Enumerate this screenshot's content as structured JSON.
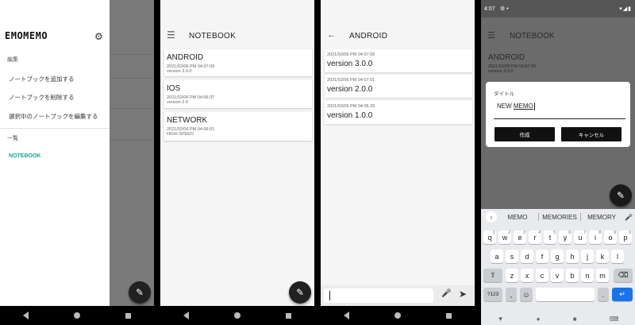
{
  "drawer": {
    "logo": "EMOMEMO",
    "section_edit": "編集",
    "item_add": "ノートブックを追加する",
    "item_delete": "ノートブックを削除する",
    "item_edit_selected": "選択中のノートブックを編集する",
    "section_list": "一覧",
    "notebook_item": "NOTEBOOK"
  },
  "notebook_screen": {
    "title": "NOTEBOOK",
    "notebooks": [
      {
        "title": "ANDROID",
        "date": "2021/02/06 PM 04:07:09",
        "desc": "version 3.0.0"
      },
      {
        "title": "IOS",
        "date": "2021/02/06 PM 04:06:37",
        "desc": "version 2.0"
      },
      {
        "title": "NETWORK",
        "date": "2021/02/06 PM 04:06:51",
        "desc": "HIGH SPEED"
      }
    ]
  },
  "android_screen": {
    "title": "ANDROID",
    "memos": [
      {
        "date": "2021/02/06 PM 04:07:09",
        "title": "version 3.0.0"
      },
      {
        "date": "2021/02/06 PM 04:07:01",
        "title": "version 2.0.0"
      },
      {
        "date": "2021/02/06 PM 04:06:29",
        "title": "version 1.0.0"
      }
    ]
  },
  "dialog_screen": {
    "status_time": "4:07",
    "bg_title": "NOTEBOOK",
    "bg_card_title": "ANDROID",
    "bg_card_date": "2021/02/06 PM 04:07:09",
    "bg_card_desc": "version 3.0.0",
    "dialog_label": "タイトル",
    "input_prefix": "NEW ",
    "input_underlined": "MEMO",
    "create_button": "作成",
    "cancel_button": "キャンセル"
  },
  "keyboard": {
    "suggestions": [
      "MEMO",
      "MEMORIES",
      "MEMORY"
    ],
    "row1": [
      [
        "q",
        "1"
      ],
      [
        "w",
        "2"
      ],
      [
        "e",
        "3"
      ],
      [
        "r",
        "4"
      ],
      [
        "t",
        "5"
      ],
      [
        "y",
        "6"
      ],
      [
        "u",
        "7"
      ],
      [
        "i",
        "8"
      ],
      [
        "o",
        "9"
      ],
      [
        "p",
        "0"
      ]
    ],
    "row2": [
      "a",
      "s",
      "d",
      "f",
      "g",
      "h",
      "j",
      "k",
      "l"
    ],
    "row3": [
      "z",
      "x",
      "c",
      "v",
      "b",
      "n",
      "m"
    ],
    "symbols_key": "?123",
    "comma_key": ",",
    "period_key": "."
  },
  "icons": {
    "gear": "gear-icon",
    "pencil": "pencil-icon",
    "hamburger": "menu-icon",
    "back": "back-arrow-icon",
    "mic": "mic-icon",
    "send": "send-icon"
  },
  "colors": {
    "accent": "#14a79c",
    "fab": "#212121",
    "keyboard_enter": "#1a73e8"
  }
}
